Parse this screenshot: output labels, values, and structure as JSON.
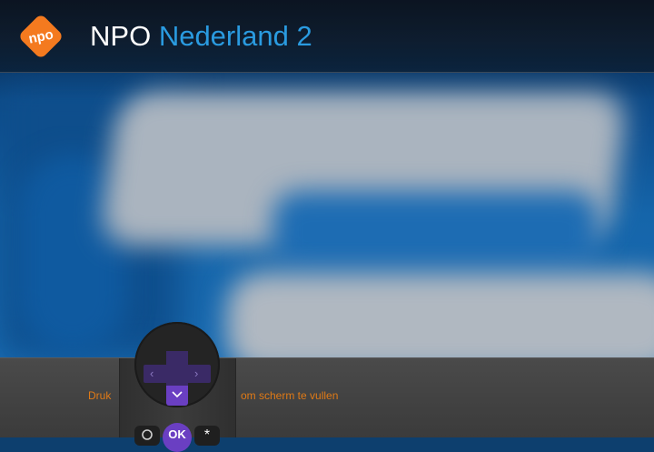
{
  "header": {
    "logo_text": "npo",
    "brand": "NPO",
    "channel": "Nederland 2",
    "colors": {
      "logo": "#f47a1f",
      "channel": "#2a9be0"
    }
  },
  "hint": {
    "before": "Druk",
    "after": "om scherm te vullen",
    "color": "#e07a16"
  },
  "remote": {
    "ok_label": "OK",
    "star_label": "*",
    "icons": [
      "left-arrow-icon",
      "right-arrow-icon",
      "down-arrow-icon",
      "back-icon"
    ]
  }
}
